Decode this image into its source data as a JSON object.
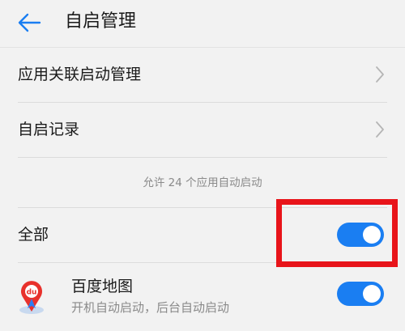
{
  "header": {
    "back_icon": "arrow-left-icon",
    "title": "自启管理"
  },
  "menu": [
    {
      "label": "应用关联启动管理",
      "icon": "chevron-right-icon"
    },
    {
      "label": "自启记录",
      "icon": "chevron-right-icon"
    }
  ],
  "note": "允许 24 个应用自动启动",
  "all_toggle": {
    "label": "全部",
    "on": true
  },
  "apps": [
    {
      "name": "百度地图",
      "status": "开机自动启动，后台自动启动",
      "on": true,
      "icon": "baidu-map-icon"
    }
  ],
  "colors": {
    "accent": "#1a7ef2",
    "highlight": "#e8141a",
    "background": "#f2f2f2"
  }
}
